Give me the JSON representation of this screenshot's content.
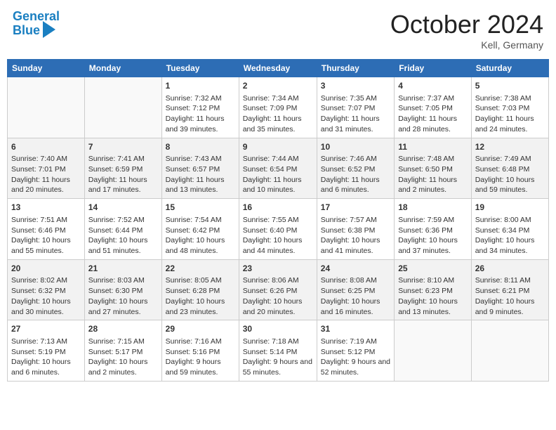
{
  "header": {
    "logo_line1": "General",
    "logo_line2": "Blue",
    "month": "October 2024",
    "location": "Kell, Germany"
  },
  "days_of_week": [
    "Sunday",
    "Monday",
    "Tuesday",
    "Wednesday",
    "Thursday",
    "Friday",
    "Saturday"
  ],
  "weeks": [
    [
      {
        "day": "",
        "sunrise": "",
        "sunset": "",
        "daylight": ""
      },
      {
        "day": "",
        "sunrise": "",
        "sunset": "",
        "daylight": ""
      },
      {
        "day": "1",
        "sunrise": "Sunrise: 7:32 AM",
        "sunset": "Sunset: 7:12 PM",
        "daylight": "Daylight: 11 hours and 39 minutes."
      },
      {
        "day": "2",
        "sunrise": "Sunrise: 7:34 AM",
        "sunset": "Sunset: 7:09 PM",
        "daylight": "Daylight: 11 hours and 35 minutes."
      },
      {
        "day": "3",
        "sunrise": "Sunrise: 7:35 AM",
        "sunset": "Sunset: 7:07 PM",
        "daylight": "Daylight: 11 hours and 31 minutes."
      },
      {
        "day": "4",
        "sunrise": "Sunrise: 7:37 AM",
        "sunset": "Sunset: 7:05 PM",
        "daylight": "Daylight: 11 hours and 28 minutes."
      },
      {
        "day": "5",
        "sunrise": "Sunrise: 7:38 AM",
        "sunset": "Sunset: 7:03 PM",
        "daylight": "Daylight: 11 hours and 24 minutes."
      }
    ],
    [
      {
        "day": "6",
        "sunrise": "Sunrise: 7:40 AM",
        "sunset": "Sunset: 7:01 PM",
        "daylight": "Daylight: 11 hours and 20 minutes."
      },
      {
        "day": "7",
        "sunrise": "Sunrise: 7:41 AM",
        "sunset": "Sunset: 6:59 PM",
        "daylight": "Daylight: 11 hours and 17 minutes."
      },
      {
        "day": "8",
        "sunrise": "Sunrise: 7:43 AM",
        "sunset": "Sunset: 6:57 PM",
        "daylight": "Daylight: 11 hours and 13 minutes."
      },
      {
        "day": "9",
        "sunrise": "Sunrise: 7:44 AM",
        "sunset": "Sunset: 6:54 PM",
        "daylight": "Daylight: 11 hours and 10 minutes."
      },
      {
        "day": "10",
        "sunrise": "Sunrise: 7:46 AM",
        "sunset": "Sunset: 6:52 PM",
        "daylight": "Daylight: 11 hours and 6 minutes."
      },
      {
        "day": "11",
        "sunrise": "Sunrise: 7:48 AM",
        "sunset": "Sunset: 6:50 PM",
        "daylight": "Daylight: 11 hours and 2 minutes."
      },
      {
        "day": "12",
        "sunrise": "Sunrise: 7:49 AM",
        "sunset": "Sunset: 6:48 PM",
        "daylight": "Daylight: 10 hours and 59 minutes."
      }
    ],
    [
      {
        "day": "13",
        "sunrise": "Sunrise: 7:51 AM",
        "sunset": "Sunset: 6:46 PM",
        "daylight": "Daylight: 10 hours and 55 minutes."
      },
      {
        "day": "14",
        "sunrise": "Sunrise: 7:52 AM",
        "sunset": "Sunset: 6:44 PM",
        "daylight": "Daylight: 10 hours and 51 minutes."
      },
      {
        "day": "15",
        "sunrise": "Sunrise: 7:54 AM",
        "sunset": "Sunset: 6:42 PM",
        "daylight": "Daylight: 10 hours and 48 minutes."
      },
      {
        "day": "16",
        "sunrise": "Sunrise: 7:55 AM",
        "sunset": "Sunset: 6:40 PM",
        "daylight": "Daylight: 10 hours and 44 minutes."
      },
      {
        "day": "17",
        "sunrise": "Sunrise: 7:57 AM",
        "sunset": "Sunset: 6:38 PM",
        "daylight": "Daylight: 10 hours and 41 minutes."
      },
      {
        "day": "18",
        "sunrise": "Sunrise: 7:59 AM",
        "sunset": "Sunset: 6:36 PM",
        "daylight": "Daylight: 10 hours and 37 minutes."
      },
      {
        "day": "19",
        "sunrise": "Sunrise: 8:00 AM",
        "sunset": "Sunset: 6:34 PM",
        "daylight": "Daylight: 10 hours and 34 minutes."
      }
    ],
    [
      {
        "day": "20",
        "sunrise": "Sunrise: 8:02 AM",
        "sunset": "Sunset: 6:32 PM",
        "daylight": "Daylight: 10 hours and 30 minutes."
      },
      {
        "day": "21",
        "sunrise": "Sunrise: 8:03 AM",
        "sunset": "Sunset: 6:30 PM",
        "daylight": "Daylight: 10 hours and 27 minutes."
      },
      {
        "day": "22",
        "sunrise": "Sunrise: 8:05 AM",
        "sunset": "Sunset: 6:28 PM",
        "daylight": "Daylight: 10 hours and 23 minutes."
      },
      {
        "day": "23",
        "sunrise": "Sunrise: 8:06 AM",
        "sunset": "Sunset: 6:26 PM",
        "daylight": "Daylight: 10 hours and 20 minutes."
      },
      {
        "day": "24",
        "sunrise": "Sunrise: 8:08 AM",
        "sunset": "Sunset: 6:25 PM",
        "daylight": "Daylight: 10 hours and 16 minutes."
      },
      {
        "day": "25",
        "sunrise": "Sunrise: 8:10 AM",
        "sunset": "Sunset: 6:23 PM",
        "daylight": "Daylight: 10 hours and 13 minutes."
      },
      {
        "day": "26",
        "sunrise": "Sunrise: 8:11 AM",
        "sunset": "Sunset: 6:21 PM",
        "daylight": "Daylight: 10 hours and 9 minutes."
      }
    ],
    [
      {
        "day": "27",
        "sunrise": "Sunrise: 7:13 AM",
        "sunset": "Sunset: 5:19 PM",
        "daylight": "Daylight: 10 hours and 6 minutes."
      },
      {
        "day": "28",
        "sunrise": "Sunrise: 7:15 AM",
        "sunset": "Sunset: 5:17 PM",
        "daylight": "Daylight: 10 hours and 2 minutes."
      },
      {
        "day": "29",
        "sunrise": "Sunrise: 7:16 AM",
        "sunset": "Sunset: 5:16 PM",
        "daylight": "Daylight: 9 hours and 59 minutes."
      },
      {
        "day": "30",
        "sunrise": "Sunrise: 7:18 AM",
        "sunset": "Sunset: 5:14 PM",
        "daylight": "Daylight: 9 hours and 55 minutes."
      },
      {
        "day": "31",
        "sunrise": "Sunrise: 7:19 AM",
        "sunset": "Sunset: 5:12 PM",
        "daylight": "Daylight: 9 hours and 52 minutes."
      },
      {
        "day": "",
        "sunrise": "",
        "sunset": "",
        "daylight": ""
      },
      {
        "day": "",
        "sunrise": "",
        "sunset": "",
        "daylight": ""
      }
    ]
  ]
}
